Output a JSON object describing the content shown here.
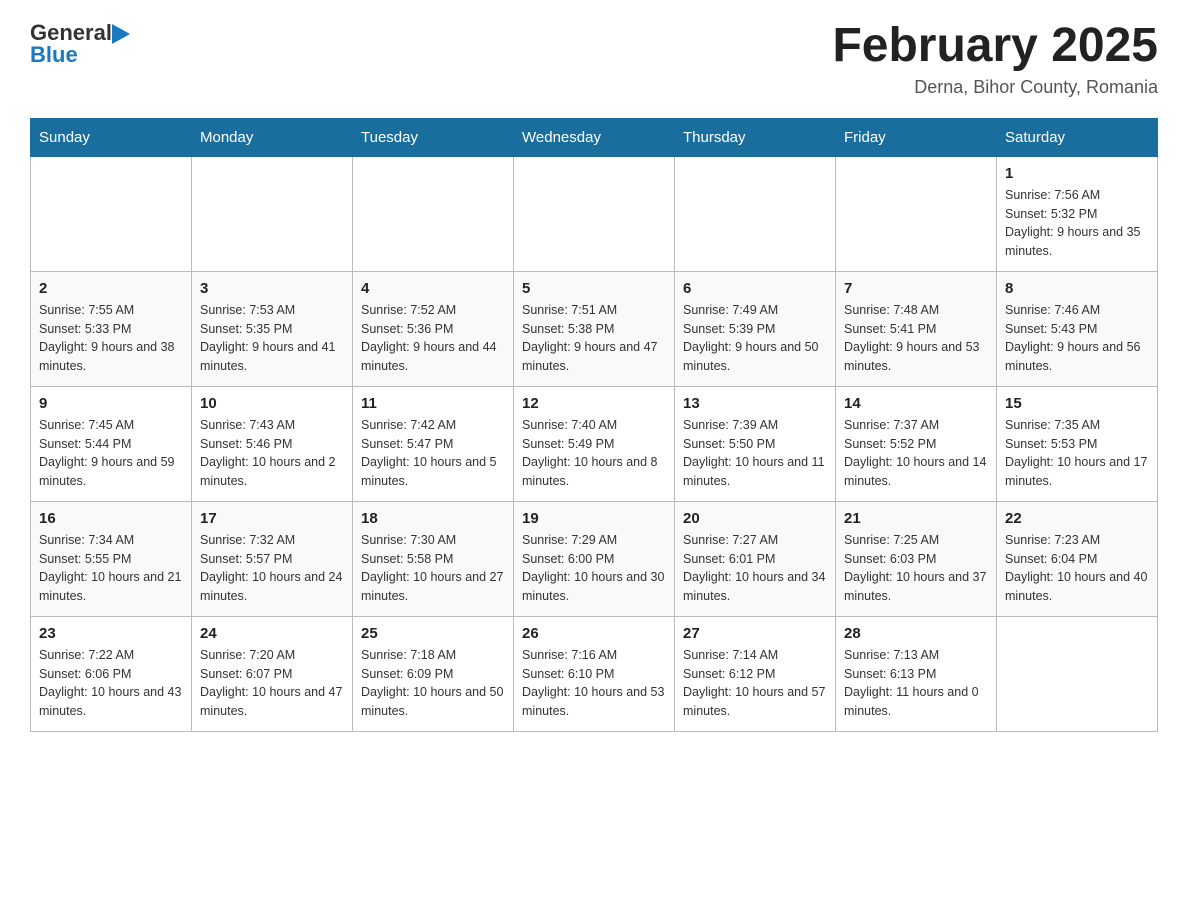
{
  "header": {
    "logo": {
      "general": "General",
      "blue": "Blue"
    },
    "title": "February 2025",
    "subtitle": "Derna, Bihor County, Romania"
  },
  "calendar": {
    "days_of_week": [
      "Sunday",
      "Monday",
      "Tuesday",
      "Wednesday",
      "Thursday",
      "Friday",
      "Saturday"
    ],
    "weeks": [
      [
        {
          "day": "",
          "info": ""
        },
        {
          "day": "",
          "info": ""
        },
        {
          "day": "",
          "info": ""
        },
        {
          "day": "",
          "info": ""
        },
        {
          "day": "",
          "info": ""
        },
        {
          "day": "",
          "info": ""
        },
        {
          "day": "1",
          "info": "Sunrise: 7:56 AM\nSunset: 5:32 PM\nDaylight: 9 hours and 35 minutes."
        }
      ],
      [
        {
          "day": "2",
          "info": "Sunrise: 7:55 AM\nSunset: 5:33 PM\nDaylight: 9 hours and 38 minutes."
        },
        {
          "day": "3",
          "info": "Sunrise: 7:53 AM\nSunset: 5:35 PM\nDaylight: 9 hours and 41 minutes."
        },
        {
          "day": "4",
          "info": "Sunrise: 7:52 AM\nSunset: 5:36 PM\nDaylight: 9 hours and 44 minutes."
        },
        {
          "day": "5",
          "info": "Sunrise: 7:51 AM\nSunset: 5:38 PM\nDaylight: 9 hours and 47 minutes."
        },
        {
          "day": "6",
          "info": "Sunrise: 7:49 AM\nSunset: 5:39 PM\nDaylight: 9 hours and 50 minutes."
        },
        {
          "day": "7",
          "info": "Sunrise: 7:48 AM\nSunset: 5:41 PM\nDaylight: 9 hours and 53 minutes."
        },
        {
          "day": "8",
          "info": "Sunrise: 7:46 AM\nSunset: 5:43 PM\nDaylight: 9 hours and 56 minutes."
        }
      ],
      [
        {
          "day": "9",
          "info": "Sunrise: 7:45 AM\nSunset: 5:44 PM\nDaylight: 9 hours and 59 minutes."
        },
        {
          "day": "10",
          "info": "Sunrise: 7:43 AM\nSunset: 5:46 PM\nDaylight: 10 hours and 2 minutes."
        },
        {
          "day": "11",
          "info": "Sunrise: 7:42 AM\nSunset: 5:47 PM\nDaylight: 10 hours and 5 minutes."
        },
        {
          "day": "12",
          "info": "Sunrise: 7:40 AM\nSunset: 5:49 PM\nDaylight: 10 hours and 8 minutes."
        },
        {
          "day": "13",
          "info": "Sunrise: 7:39 AM\nSunset: 5:50 PM\nDaylight: 10 hours and 11 minutes."
        },
        {
          "day": "14",
          "info": "Sunrise: 7:37 AM\nSunset: 5:52 PM\nDaylight: 10 hours and 14 minutes."
        },
        {
          "day": "15",
          "info": "Sunrise: 7:35 AM\nSunset: 5:53 PM\nDaylight: 10 hours and 17 minutes."
        }
      ],
      [
        {
          "day": "16",
          "info": "Sunrise: 7:34 AM\nSunset: 5:55 PM\nDaylight: 10 hours and 21 minutes."
        },
        {
          "day": "17",
          "info": "Sunrise: 7:32 AM\nSunset: 5:57 PM\nDaylight: 10 hours and 24 minutes."
        },
        {
          "day": "18",
          "info": "Sunrise: 7:30 AM\nSunset: 5:58 PM\nDaylight: 10 hours and 27 minutes."
        },
        {
          "day": "19",
          "info": "Sunrise: 7:29 AM\nSunset: 6:00 PM\nDaylight: 10 hours and 30 minutes."
        },
        {
          "day": "20",
          "info": "Sunrise: 7:27 AM\nSunset: 6:01 PM\nDaylight: 10 hours and 34 minutes."
        },
        {
          "day": "21",
          "info": "Sunrise: 7:25 AM\nSunset: 6:03 PM\nDaylight: 10 hours and 37 minutes."
        },
        {
          "day": "22",
          "info": "Sunrise: 7:23 AM\nSunset: 6:04 PM\nDaylight: 10 hours and 40 minutes."
        }
      ],
      [
        {
          "day": "23",
          "info": "Sunrise: 7:22 AM\nSunset: 6:06 PM\nDaylight: 10 hours and 43 minutes."
        },
        {
          "day": "24",
          "info": "Sunrise: 7:20 AM\nSunset: 6:07 PM\nDaylight: 10 hours and 47 minutes."
        },
        {
          "day": "25",
          "info": "Sunrise: 7:18 AM\nSunset: 6:09 PM\nDaylight: 10 hours and 50 minutes."
        },
        {
          "day": "26",
          "info": "Sunrise: 7:16 AM\nSunset: 6:10 PM\nDaylight: 10 hours and 53 minutes."
        },
        {
          "day": "27",
          "info": "Sunrise: 7:14 AM\nSunset: 6:12 PM\nDaylight: 10 hours and 57 minutes."
        },
        {
          "day": "28",
          "info": "Sunrise: 7:13 AM\nSunset: 6:13 PM\nDaylight: 11 hours and 0 minutes."
        },
        {
          "day": "",
          "info": ""
        }
      ]
    ]
  }
}
